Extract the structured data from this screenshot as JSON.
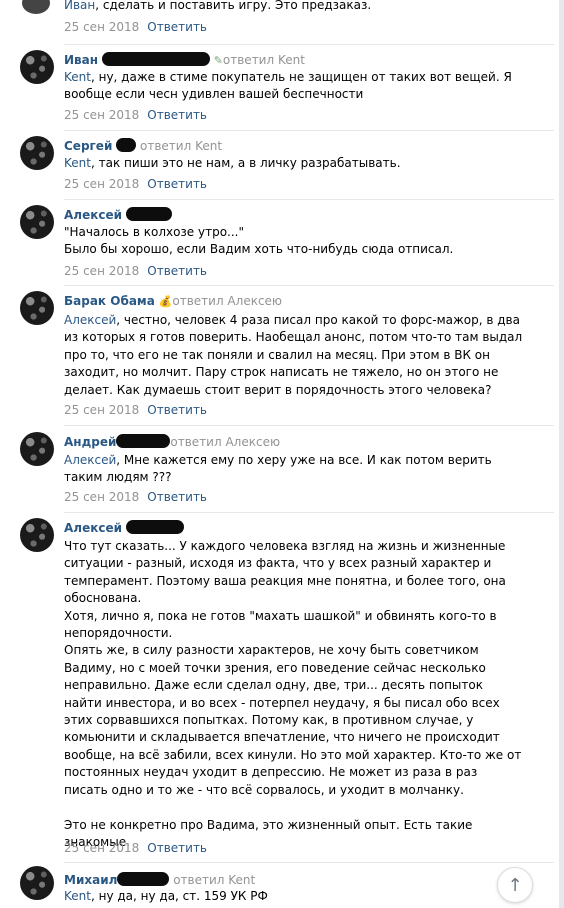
{
  "reply_label": "Ответить",
  "top": {
    "text": "Иван, сделать и поставить игру. Это предзаказ.",
    "date": "25 сен 2018"
  },
  "comments": [
    {
      "author": "Иван",
      "reply_to": "ответил Kent",
      "addressee": "Kent",
      "text": ", ну, даже в стиме покупатель не защищен от таких вот вещей. Я вообще если чесн удивлен вашей беспечности",
      "date": "25 сен 2018"
    },
    {
      "author": "Сергей",
      "reply_to": "ответил Kent",
      "addressee": "Kent",
      "text": ", так пиши это не нам, а в личку разрабатывать.",
      "date": "25 сен 2018"
    },
    {
      "author": "Алексей",
      "reply_to": "",
      "addressee": "",
      "text": "\"Началось в колхозе утро...\"\nБыло бы хорошо, если Вадим хоть что-нибудь сюда отписал.",
      "date": "25 сен 2018"
    },
    {
      "author": "Барак Обама",
      "reply_to": "ответил Алексею",
      "addressee": "Алексей",
      "text": ", честно, человек 4 раза писал про какой то форс-мажор, в два из которых я готов поверить. Наобещал анонс, потом что-то там выдал про то, что его не так поняли и свалил на месяц. При этом в ВК он заходит, но молчит. Пару строк написать не тяжело, но он этого не делает. Как думаешь стоит верит в порядочность этого человека?",
      "date": "25 сен 2018"
    },
    {
      "author": "Андрей",
      "reply_to": "ответил Алексею",
      "addressee": "Алексей",
      "text": ", Мне кажется ему по херу уже на все. И как потом верить таким людям ???",
      "date": "25 сен 2018"
    },
    {
      "author": "Алексей",
      "reply_to": "",
      "addressee": "",
      "text": "Что тут сказать... У каждого человека взгляд на жизнь и жизненные ситуации - разный, исходя из факта, что у всех разный характер и темперамент. Поэтому ваша реакция мне понятна, и более того, она обоснована.\nХотя, лично я, пока не готов \"махать шашкой\" и обвинять кого-то в непорядочности.\nОпять же, в силу разности характеров, не хочу быть советчиком Вадиму, но с моей точки зрения, его поведение сейчас несколько неправильно. Даже если сделал одну, две, три... десять попыток найти инвестора, и во всех - потерпел неудачу, я бы писал обо всех этих сорвавшихся попытках. Потому как, в противном случае, у комьюнити и складывается впечатление, что ничего не происходит вообще, на всё забили, всех кинули. Но это мой характер. Кто-то же от постоянных неудач уходит в депрессию. Не может из раза в раз писать одно и то же - что всё сорвалось, и уходит в молчанку.\n\nЭто не конкретно про Вадима, это жизненный опыт. Есть такие знакомые.",
      "date": "25 сен 2018"
    },
    {
      "author": "Михаил",
      "reply_to": "ответил Kent",
      "addressee": "Kent",
      "text": ", ну да, ну да, ст. 159 УК РФ",
      "date": ""
    }
  ]
}
